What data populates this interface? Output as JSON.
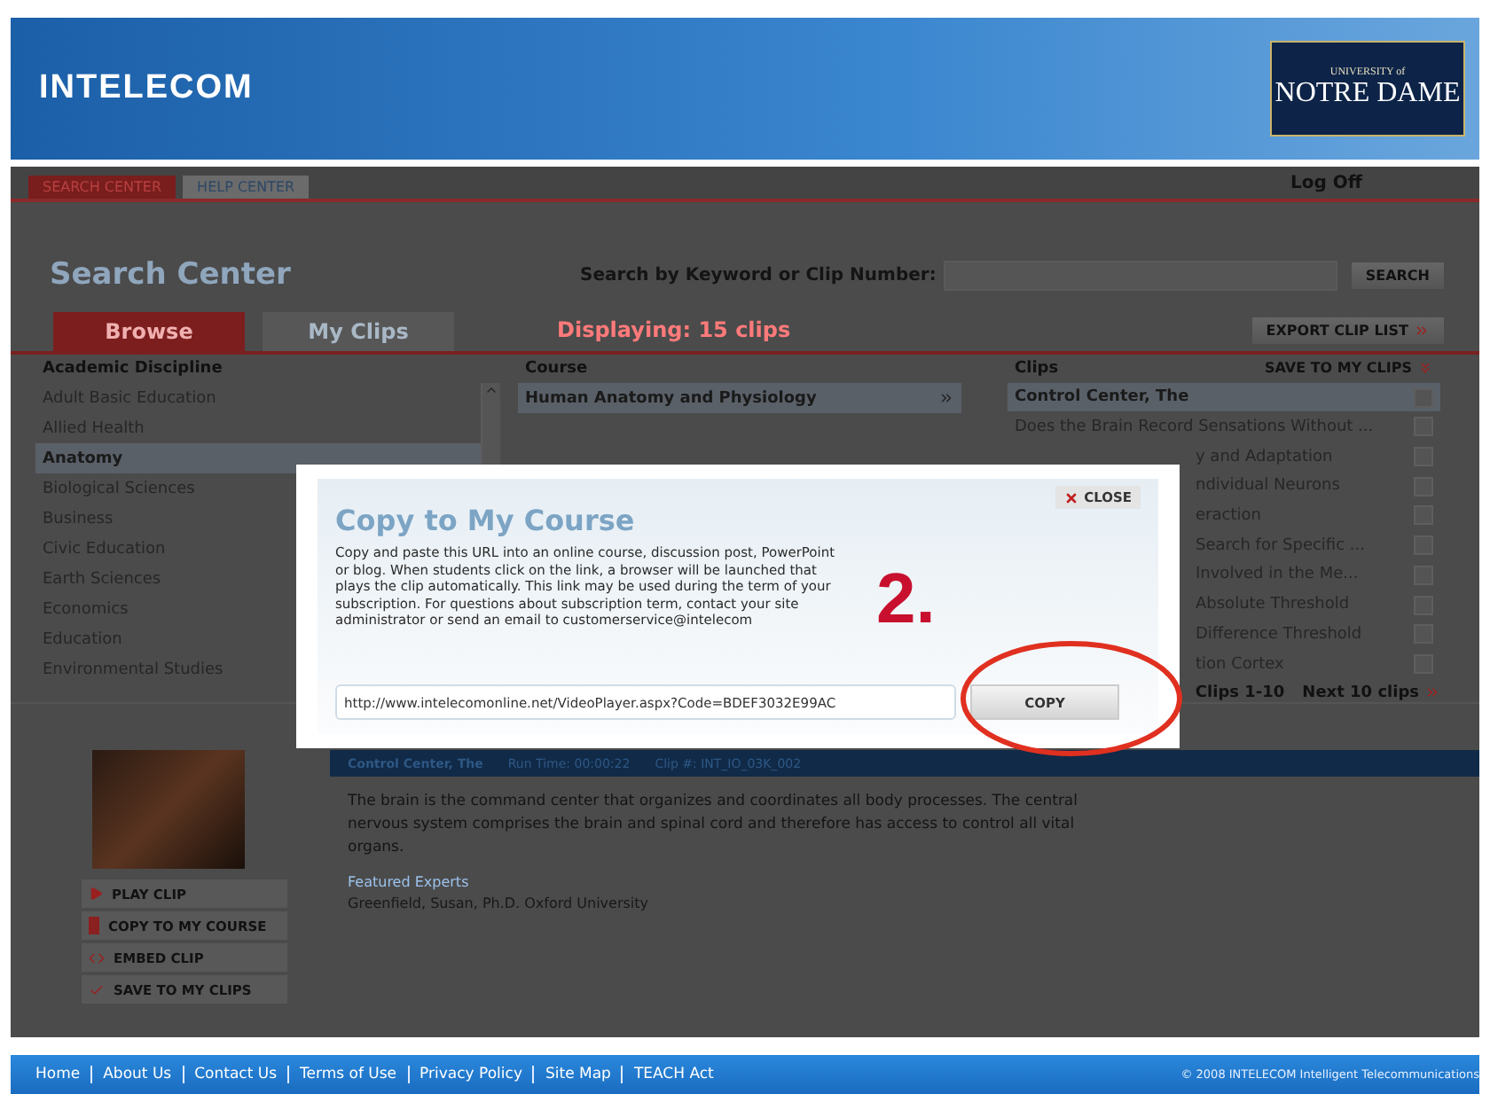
{
  "header": {
    "logo": "INTELECOM",
    "partner_small": "UNIVERSITY of",
    "partner_name": "NOTRE DAME"
  },
  "nav": {
    "tabs": [
      {
        "label": "SEARCH CENTER",
        "selected": true
      },
      {
        "label": "HELP CENTER",
        "selected": false
      }
    ],
    "log_off": "Log Off"
  },
  "search": {
    "title": "Search Center",
    "label": "Search by Keyword or Clip Number:",
    "button": "SEARCH"
  },
  "view_tabs": [
    {
      "label": "Browse",
      "selected": true
    },
    {
      "label": "My Clips",
      "selected": false
    }
  ],
  "displaying": "Displaying: 15 clips",
  "export_button": "EXPORT CLIP LIST",
  "disciplines": {
    "heading": "Academic Discipline",
    "items": [
      {
        "label": "Adult Basic Education",
        "selected": false
      },
      {
        "label": "Allied Health",
        "selected": false
      },
      {
        "label": "Anatomy",
        "selected": true
      },
      {
        "label": "Biological Sciences",
        "selected": false
      },
      {
        "label": "Business",
        "selected": false
      },
      {
        "label": "Civic Education",
        "selected": false
      },
      {
        "label": "Earth Sciences",
        "selected": false
      },
      {
        "label": "Economics",
        "selected": false
      },
      {
        "label": "Education",
        "selected": false
      },
      {
        "label": "Environmental Studies",
        "selected": false
      }
    ]
  },
  "courses": {
    "heading": "Course",
    "items": [
      {
        "label": "Human Anatomy and Physiology",
        "selected": true
      }
    ]
  },
  "clips": {
    "heading": "Clips",
    "save_button": "SAVE TO MY CLIPS",
    "items": [
      {
        "title": "Control Center, The",
        "selected": true,
        "checked": false
      },
      {
        "title": "Does the Brain Record Sensations Without ...",
        "selected": false,
        "checked": false
      },
      {
        "title": "y and Adaptation",
        "selected": false,
        "checked": false
      },
      {
        "title": "ndividual Neurons",
        "selected": false,
        "checked": false
      },
      {
        "title": "eraction",
        "selected": false,
        "checked": false
      },
      {
        "title": "Search for Specific ...",
        "selected": false,
        "checked": false
      },
      {
        "title": "Involved in the Me...",
        "selected": false,
        "checked": false
      },
      {
        "title": "Absolute Threshold",
        "selected": false,
        "checked": false
      },
      {
        "title": "Difference Threshold",
        "selected": false,
        "checked": false
      },
      {
        "title": "tion Cortex",
        "selected": false,
        "checked": false
      }
    ],
    "range": "Clips 1-10",
    "next": "Next 10 clips"
  },
  "clip_detail": {
    "title": "Control Center, The",
    "run_time": "Run Time: 00:00:22",
    "clip_number": "Clip #: INT_IO_03K_002",
    "description": "The brain is the command center that organizes and coordinates all body processes. The central nervous system comprises the brain and spinal cord and therefore has access to control all vital organs.",
    "experts_label": "Featured Experts",
    "expert": "Greenfield, Susan, Ph.D. Oxford University"
  },
  "actions": [
    {
      "label": "PLAY CLIP",
      "kind": "play"
    },
    {
      "label": "COPY TO MY COURSE",
      "kind": "copy"
    },
    {
      "label": "EMBED CLIP",
      "kind": "embed"
    },
    {
      "label": "SAVE TO MY CLIPS",
      "kind": "save"
    }
  ],
  "footer": {
    "links": [
      "Home",
      "About Us",
      "Contact Us",
      "Terms of Use",
      "Privacy Policy",
      "Site Map",
      "TEACH Act"
    ],
    "copyright": "© 2008 INTELECOM Intelligent Telecommunications"
  },
  "dialog": {
    "title": "Copy to My Course",
    "close": "CLOSE",
    "message": "Copy and paste this URL into an online course, discussion post, PowerPoint or blog. When students click on the link, a browser will be launched that plays the clip automatically. This link may be used during the term of your subscription. For questions about subscription term, contact your site administrator or send an email to customerservice@intelecom",
    "url": "http://www.intelecomonline.net/VideoPlayer.aspx?Code=BDEF3032E99AC",
    "copy_button": "COPY"
  },
  "annotation": {
    "step": "2."
  }
}
